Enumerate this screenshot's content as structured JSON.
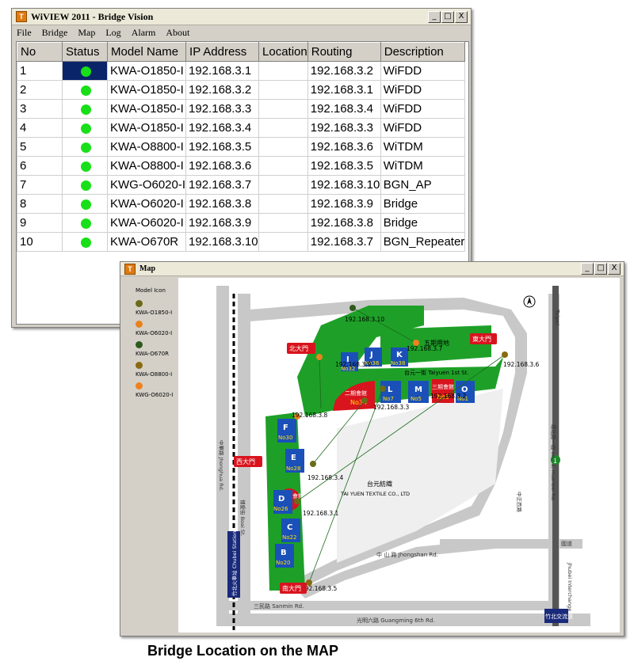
{
  "main_window": {
    "title": "WiVIEW 2011 - Bridge Vision",
    "buttons": {
      "minimize": "_",
      "maximize": "□",
      "close": "X"
    },
    "menu": [
      "File",
      "Bridge",
      "Map",
      "Log",
      "Alarm",
      "About"
    ],
    "columns": [
      "No",
      "Status",
      "Model Name",
      "IP Address",
      "Location",
      "Routing",
      "Description"
    ],
    "rows": [
      {
        "no": "1",
        "status": "online",
        "model": "KWA-O1850-I",
        "ip": "192.168.3.1",
        "location": "",
        "routing": "192.168.3.2",
        "description": "WiFDD"
      },
      {
        "no": "2",
        "status": "online",
        "model": "KWA-O1850-I",
        "ip": "192.168.3.2",
        "location": "",
        "routing": "192.168.3.1",
        "description": "WiFDD"
      },
      {
        "no": "3",
        "status": "online",
        "model": "KWA-O1850-I",
        "ip": "192.168.3.3",
        "location": "",
        "routing": "192.168.3.4",
        "description": "WiFDD"
      },
      {
        "no": "4",
        "status": "online",
        "model": "KWA-O1850-I",
        "ip": "192.168.3.4",
        "location": "",
        "routing": "192.168.3.3",
        "description": "WiFDD"
      },
      {
        "no": "5",
        "status": "online",
        "model": "KWA-O8800-I",
        "ip": "192.168.3.5",
        "location": "",
        "routing": "192.168.3.6",
        "description": "WiTDM"
      },
      {
        "no": "6",
        "status": "online",
        "model": "KWA-O8800-I",
        "ip": "192.168.3.6",
        "location": "",
        "routing": "192.168.3.5",
        "description": "WiTDM"
      },
      {
        "no": "7",
        "status": "online",
        "model": "KWG-O6020-I",
        "ip": "192.168.3.7",
        "location": "",
        "routing": "192.168.3.10",
        "description": "BGN_AP"
      },
      {
        "no": "8",
        "status": "online",
        "model": "KWA-O6020-I",
        "ip": "192.168.3.8",
        "location": "",
        "routing": "192.168.3.9",
        "description": "Bridge"
      },
      {
        "no": "9",
        "status": "online",
        "model": "KWA-O6020-I",
        "ip": "192.168.3.9",
        "location": "",
        "routing": "192.168.3.8",
        "description": "Bridge"
      },
      {
        "no": "10",
        "status": "online",
        "model": "KWA-O670R",
        "ip": "192.168.3.10",
        "location": "",
        "routing": "192.168.3.7",
        "description": "BGN_Repeater"
      }
    ],
    "selected_row": 0,
    "status_color": "#18e018"
  },
  "map_window": {
    "title": "Map",
    "legend": {
      "title": "Model Icon",
      "items": [
        {
          "label": "KWA-O1850-I",
          "color": "#6b6b1a"
        },
        {
          "label": "KWA-O6020-I",
          "color": "#e8821e"
        },
        {
          "label": "KWA-O670R",
          "color": "#2e5a1c"
        },
        {
          "label": "KWA-O8800-I",
          "color": "#8a6a10"
        },
        {
          "label": "KWG-O6020-I",
          "color": "#f08020"
        }
      ]
    },
    "map": {
      "ip_labels": [
        "192.168.3.10",
        "192.168.3.7",
        "192.168.3.9",
        "192.168.3.6",
        "192.168.3.3",
        "192.168.3.2",
        "192.168.3.8",
        "192.168.3.4",
        "192.168.3.1",
        "192.168.3.5"
      ],
      "buildings": [
        {
          "letter": "I",
          "no": "No32"
        },
        {
          "letter": "J",
          "no": "No36"
        },
        {
          "letter": "K",
          "no": "No38"
        },
        {
          "letter": "L",
          "no": "No7"
        },
        {
          "letter": "M",
          "no": "No5"
        },
        {
          "letter": "O",
          "no": "No1"
        },
        {
          "letter": "F",
          "no": "No30"
        },
        {
          "letter": "E",
          "no": "No28"
        },
        {
          "letter": "D",
          "no": "No26"
        },
        {
          "letter": "C",
          "no": "No22"
        },
        {
          "letter": "B",
          "no": "No20"
        }
      ],
      "red_halls": [
        {
          "name": "二期會館",
          "no": "No34"
        },
        {
          "name": "三期會館",
          "no": "No3"
        },
        {
          "name": "一期會館",
          "no": ""
        }
      ],
      "gates": [
        "北大門",
        "東大門",
        "西大門",
        "南大門"
      ],
      "places": {
        "taipei": "Taipei",
        "wuqi": "五期用地",
        "taiyuan_road": "台元一街 Taiyuen 1st St.",
        "textile_cn": "台元紡織",
        "textile_en": "TAI YUEN TEXTILE CO., LTD",
        "chupei_station": "竹北火車站 Chubei Station",
        "zhonghua": "中華路 Jhonghua Rd.",
        "zhongshan": "中 山 路 Jhongshan Rd.",
        "huanbei": "環北路一段 sec. 1, Huanbei Rd.",
        "zhongzheng": "中正西路",
        "guangming": "光明六路 Guangming 6th Rd.",
        "sanmin": "三民路 Sanmin Rd.",
        "boai": "博愛街 Boai St.",
        "interchange": "竹北交流道",
        "interchange_en": "Jhubei Interchange",
        "guodao": "國道",
        "national1": "1"
      }
    }
  },
  "caption": "Bridge Location on the MAP"
}
